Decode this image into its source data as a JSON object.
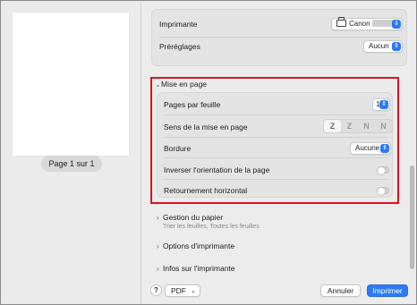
{
  "preview": {
    "page_label": "Page 1 sur 1"
  },
  "printer": {
    "label": "Imprimante",
    "value": "Canon",
    "icon": "printer-icon"
  },
  "presets": {
    "label": "Préréglages",
    "value": "Aucun"
  },
  "layout": {
    "title": "Mise en page",
    "pages_per_sheet": {
      "label": "Pages par feuille",
      "value": "1"
    },
    "orientation": {
      "label": "Sens de la mise en page",
      "options": [
        "Z",
        "Z",
        "N",
        "N"
      ],
      "selected_index": 0
    },
    "border": {
      "label": "Bordure",
      "value": "Aucune"
    },
    "reverse_orientation": {
      "label": "Inverser l'orientation de la page",
      "on": false
    },
    "flip_horizontal": {
      "label": "Retournement horizontal",
      "on": false
    }
  },
  "sections": [
    {
      "title": "Gestion du papier",
      "subtitle": "Trier les feuilles, Toutes les feuilles"
    },
    {
      "title": "Options d'imprimante",
      "subtitle": ""
    },
    {
      "title": "Infos sur l'imprimante",
      "subtitle": ""
    }
  ],
  "footer": {
    "help_label": "?",
    "pdf_label": "PDF",
    "cancel_label": "Annuler",
    "print_label": "Imprimer"
  },
  "colors": {
    "accent": "#2c7af5",
    "highlight_frame": "#d9141e"
  }
}
